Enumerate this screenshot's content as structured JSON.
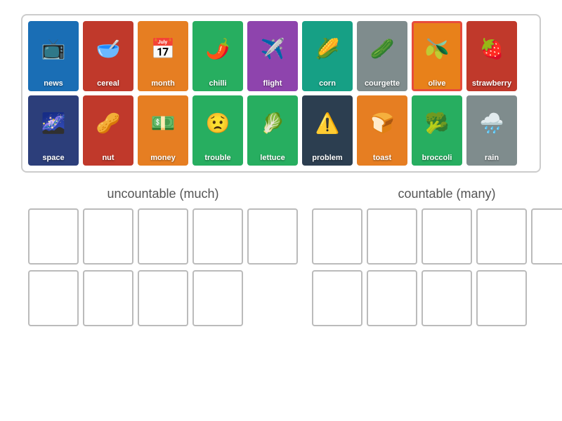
{
  "cards": {
    "row1": [
      {
        "id": "news",
        "label": "news",
        "color": "card-blue",
        "icon": "📺"
      },
      {
        "id": "cereal",
        "label": "cereal",
        "color": "card-red",
        "icon": "🥣"
      },
      {
        "id": "month",
        "label": "month",
        "color": "card-orange",
        "icon": "📅"
      },
      {
        "id": "chilli",
        "label": "chilli",
        "color": "card-green",
        "icon": "🌶️"
      },
      {
        "id": "flight",
        "label": "flight",
        "color": "card-purple",
        "icon": "✈️"
      },
      {
        "id": "corn",
        "label": "corn",
        "color": "card-teal",
        "icon": "🌽"
      },
      {
        "id": "courgette",
        "label": "courgette",
        "color": "card-gray",
        "icon": "🥒"
      },
      {
        "id": "olive",
        "label": "olive",
        "color": "card-olive",
        "icon": "🫒"
      },
      {
        "id": "strawberry",
        "label": "strawberry",
        "color": "card-red",
        "icon": "🍓"
      }
    ],
    "row2": [
      {
        "id": "space",
        "label": "space",
        "color": "card-darkblue",
        "icon": "🌌"
      },
      {
        "id": "nut",
        "label": "nut",
        "color": "card-red",
        "icon": "🥜"
      },
      {
        "id": "money",
        "label": "money",
        "color": "card-money",
        "icon": "💵"
      },
      {
        "id": "trouble",
        "label": "trouble",
        "color": "card-trouble",
        "icon": "😟"
      },
      {
        "id": "lettuce",
        "label": "lettuce",
        "color": "card-lettuce",
        "icon": "🥬"
      },
      {
        "id": "problem",
        "label": "problem",
        "color": "card-problem",
        "icon": "⚠️"
      },
      {
        "id": "toast",
        "label": "toast",
        "color": "card-toast",
        "icon": "🍞"
      },
      {
        "id": "broccoli",
        "label": "broccoli",
        "color": "card-broccoli",
        "icon": "🥦"
      },
      {
        "id": "rain",
        "label": "rain",
        "color": "card-rain",
        "icon": "🌧️"
      }
    ]
  },
  "sections": {
    "uncountable": {
      "title": "uncountable (much)",
      "row1_count": 5,
      "row2_count": 4
    },
    "countable": {
      "title": "countable (many)",
      "row1_count": 5,
      "row2_count": 4
    }
  }
}
